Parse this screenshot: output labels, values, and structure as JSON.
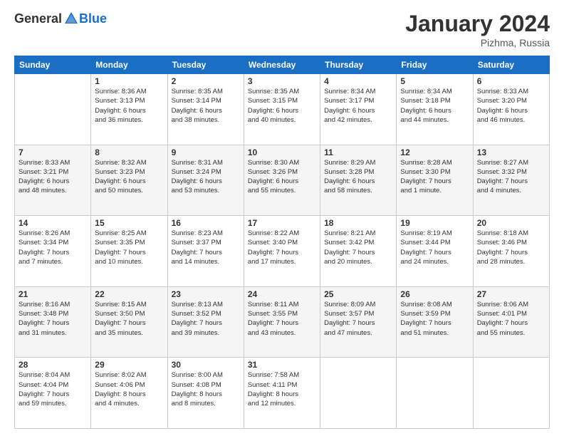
{
  "header": {
    "logo_general": "General",
    "logo_blue": "Blue",
    "month_title": "January 2024",
    "location": "Pizhma, Russia"
  },
  "weekdays": [
    "Sunday",
    "Monday",
    "Tuesday",
    "Wednesday",
    "Thursday",
    "Friday",
    "Saturday"
  ],
  "weeks": [
    [
      {
        "day": "",
        "info": ""
      },
      {
        "day": "1",
        "info": "Sunrise: 8:36 AM\nSunset: 3:13 PM\nDaylight: 6 hours\nand 36 minutes."
      },
      {
        "day": "2",
        "info": "Sunrise: 8:35 AM\nSunset: 3:14 PM\nDaylight: 6 hours\nand 38 minutes."
      },
      {
        "day": "3",
        "info": "Sunrise: 8:35 AM\nSunset: 3:15 PM\nDaylight: 6 hours\nand 40 minutes."
      },
      {
        "day": "4",
        "info": "Sunrise: 8:34 AM\nSunset: 3:17 PM\nDaylight: 6 hours\nand 42 minutes."
      },
      {
        "day": "5",
        "info": "Sunrise: 8:34 AM\nSunset: 3:18 PM\nDaylight: 6 hours\nand 44 minutes."
      },
      {
        "day": "6",
        "info": "Sunrise: 8:33 AM\nSunset: 3:20 PM\nDaylight: 6 hours\nand 46 minutes."
      }
    ],
    [
      {
        "day": "7",
        "info": "Sunrise: 8:33 AM\nSunset: 3:21 PM\nDaylight: 6 hours\nand 48 minutes."
      },
      {
        "day": "8",
        "info": "Sunrise: 8:32 AM\nSunset: 3:23 PM\nDaylight: 6 hours\nand 50 minutes."
      },
      {
        "day": "9",
        "info": "Sunrise: 8:31 AM\nSunset: 3:24 PM\nDaylight: 6 hours\nand 53 minutes."
      },
      {
        "day": "10",
        "info": "Sunrise: 8:30 AM\nSunset: 3:26 PM\nDaylight: 6 hours\nand 55 minutes."
      },
      {
        "day": "11",
        "info": "Sunrise: 8:29 AM\nSunset: 3:28 PM\nDaylight: 6 hours\nand 58 minutes."
      },
      {
        "day": "12",
        "info": "Sunrise: 8:28 AM\nSunset: 3:30 PM\nDaylight: 7 hours\nand 1 minute."
      },
      {
        "day": "13",
        "info": "Sunrise: 8:27 AM\nSunset: 3:32 PM\nDaylight: 7 hours\nand 4 minutes."
      }
    ],
    [
      {
        "day": "14",
        "info": "Sunrise: 8:26 AM\nSunset: 3:34 PM\nDaylight: 7 hours\nand 7 minutes."
      },
      {
        "day": "15",
        "info": "Sunrise: 8:25 AM\nSunset: 3:35 PM\nDaylight: 7 hours\nand 10 minutes."
      },
      {
        "day": "16",
        "info": "Sunrise: 8:23 AM\nSunset: 3:37 PM\nDaylight: 7 hours\nand 14 minutes."
      },
      {
        "day": "17",
        "info": "Sunrise: 8:22 AM\nSunset: 3:40 PM\nDaylight: 7 hours\nand 17 minutes."
      },
      {
        "day": "18",
        "info": "Sunrise: 8:21 AM\nSunset: 3:42 PM\nDaylight: 7 hours\nand 20 minutes."
      },
      {
        "day": "19",
        "info": "Sunrise: 8:19 AM\nSunset: 3:44 PM\nDaylight: 7 hours\nand 24 minutes."
      },
      {
        "day": "20",
        "info": "Sunrise: 8:18 AM\nSunset: 3:46 PM\nDaylight: 7 hours\nand 28 minutes."
      }
    ],
    [
      {
        "day": "21",
        "info": "Sunrise: 8:16 AM\nSunset: 3:48 PM\nDaylight: 7 hours\nand 31 minutes."
      },
      {
        "day": "22",
        "info": "Sunrise: 8:15 AM\nSunset: 3:50 PM\nDaylight: 7 hours\nand 35 minutes."
      },
      {
        "day": "23",
        "info": "Sunrise: 8:13 AM\nSunset: 3:52 PM\nDaylight: 7 hours\nand 39 minutes."
      },
      {
        "day": "24",
        "info": "Sunrise: 8:11 AM\nSunset: 3:55 PM\nDaylight: 7 hours\nand 43 minutes."
      },
      {
        "day": "25",
        "info": "Sunrise: 8:09 AM\nSunset: 3:57 PM\nDaylight: 7 hours\nand 47 minutes."
      },
      {
        "day": "26",
        "info": "Sunrise: 8:08 AM\nSunset: 3:59 PM\nDaylight: 7 hours\nand 51 minutes."
      },
      {
        "day": "27",
        "info": "Sunrise: 8:06 AM\nSunset: 4:01 PM\nDaylight: 7 hours\nand 55 minutes."
      }
    ],
    [
      {
        "day": "28",
        "info": "Sunrise: 8:04 AM\nSunset: 4:04 PM\nDaylight: 7 hours\nand 59 minutes."
      },
      {
        "day": "29",
        "info": "Sunrise: 8:02 AM\nSunset: 4:06 PM\nDaylight: 8 hours\nand 4 minutes."
      },
      {
        "day": "30",
        "info": "Sunrise: 8:00 AM\nSunset: 4:08 PM\nDaylight: 8 hours\nand 8 minutes."
      },
      {
        "day": "31",
        "info": "Sunrise: 7:58 AM\nSunset: 4:11 PM\nDaylight: 8 hours\nand 12 minutes."
      },
      {
        "day": "",
        "info": ""
      },
      {
        "day": "",
        "info": ""
      },
      {
        "day": "",
        "info": ""
      }
    ]
  ]
}
